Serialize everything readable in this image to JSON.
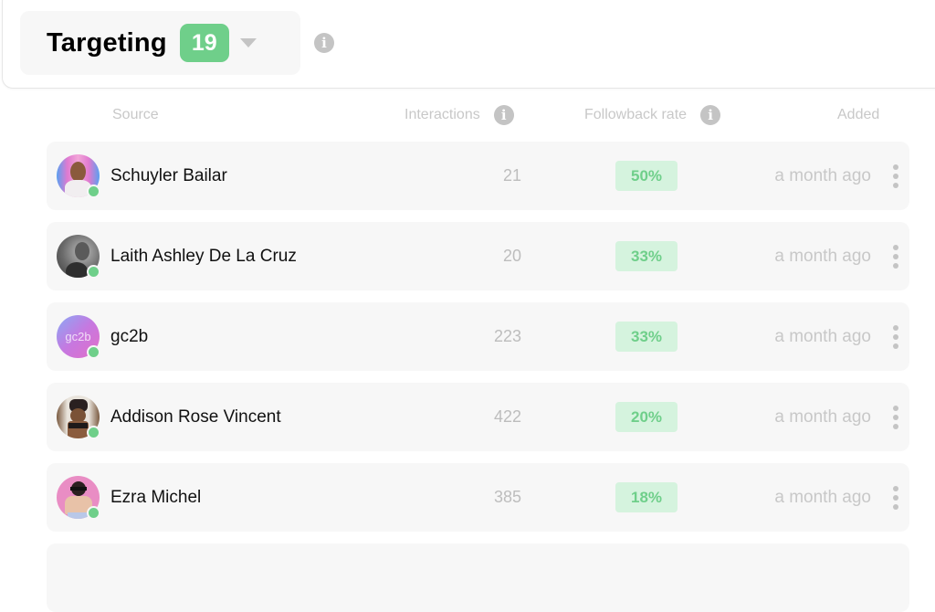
{
  "header": {
    "title": "Targeting",
    "count": "19",
    "dropdown_icon": "caret-down-icon",
    "info_icon": "info-icon"
  },
  "columns": {
    "source": "Source",
    "interactions": "Interactions",
    "followback_rate": "Followback rate",
    "added": "Added"
  },
  "colors": {
    "accent_green": "#6fcf8a",
    "rate_badge_bg": "#d5f3de",
    "row_bg": "#f7f7f7",
    "muted_text": "#c8c8c8"
  },
  "rows": [
    {
      "name": "Schuyler Bailar",
      "interactions": "21",
      "followback_rate": "50%",
      "added": "a month ago",
      "online": true,
      "avatar_text": ""
    },
    {
      "name": "Laith Ashley De La Cruz",
      "interactions": "20",
      "followback_rate": "33%",
      "added": "a month ago",
      "online": true,
      "avatar_text": ""
    },
    {
      "name": "gc2b",
      "interactions": "223",
      "followback_rate": "33%",
      "added": "a month ago",
      "online": true,
      "avatar_text": "gc2b"
    },
    {
      "name": "Addison Rose Vincent",
      "interactions": "422",
      "followback_rate": "20%",
      "added": "a month ago",
      "online": true,
      "avatar_text": ""
    },
    {
      "name": "Ezra Michel",
      "interactions": "385",
      "followback_rate": "18%",
      "added": "a month ago",
      "online": true,
      "avatar_text": ""
    }
  ]
}
